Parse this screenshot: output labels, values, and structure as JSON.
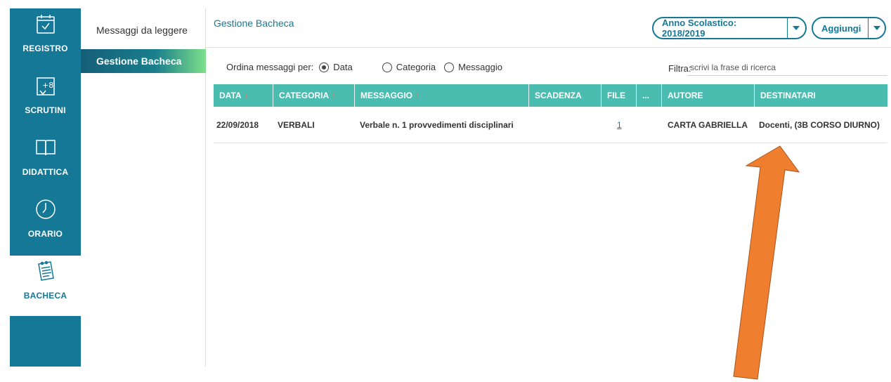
{
  "nav": {
    "items": [
      {
        "label": "REGISTRO",
        "icon": "calendar-check-icon"
      },
      {
        "label": "SCRUTINI",
        "icon": "grade-plus-icon"
      },
      {
        "label": "DIDATTICA",
        "icon": "book-icon"
      },
      {
        "label": "ORARIO",
        "icon": "clock-icon"
      },
      {
        "label": "BACHECA",
        "icon": "notepad-icon",
        "active": true
      }
    ]
  },
  "submenu": {
    "items": [
      {
        "label": "Messaggi da leggere"
      },
      {
        "label": "Gestione Bacheca",
        "active": true
      }
    ]
  },
  "header": {
    "title": "Gestione Bacheca",
    "anno_label": "Anno Scolastico: 2018/2019",
    "aggiungi_label": "Aggiungi"
  },
  "sort": {
    "label": "Ordina messaggi per:",
    "options": [
      {
        "label": "Data",
        "selected": true
      },
      {
        "label": "Categoria",
        "selected": false
      },
      {
        "label": "Messaggio",
        "selected": false
      }
    ]
  },
  "filter": {
    "label": "Filtra:",
    "placeholder": "scrivi la frase di ricerca"
  },
  "table": {
    "columns": [
      "DATA",
      "CATEGORIA",
      "MESSAGGIO",
      "SCADENZA",
      "FILE",
      "...",
      "AUTORE",
      "DESTINATARI"
    ],
    "rows": [
      {
        "data": "22/09/2018",
        "categoria": "VERBALI",
        "messaggio": "Verbale n. 1 provvedimenti disciplinari",
        "scadenza": "",
        "file": "1",
        "autore": "CARTA GABRIELLA",
        "destinatari": "Docenti, (3B CORSO DIURNO)"
      }
    ]
  },
  "colors": {
    "nav_bg": "#157896",
    "table_header": "#4bbcb0",
    "sort_arrow": "#f16a5a",
    "annotation_arrow": "#ef7f2e"
  }
}
